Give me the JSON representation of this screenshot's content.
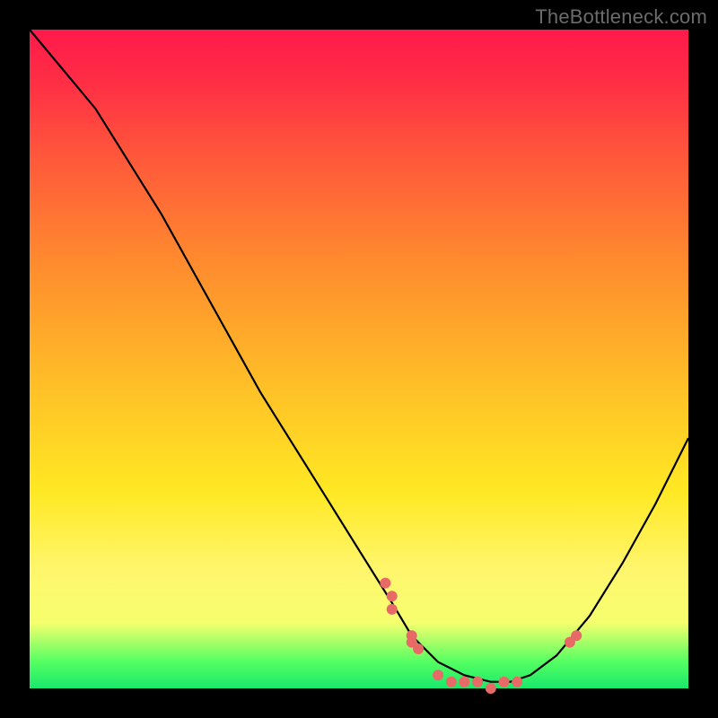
{
  "watermark": "TheBottleneck.com",
  "colors": {
    "page_background": "#000000",
    "gradient_top": "#ff1a4b",
    "gradient_mid": "#ffe823",
    "gradient_bottom": "#19e86b",
    "curve": "#000000",
    "marker": "#e86a66",
    "watermark": "#6b6b6b"
  },
  "chart_data": {
    "type": "line",
    "title": "",
    "xlabel": "",
    "ylabel": "",
    "xlim": [
      0,
      100
    ],
    "ylim": [
      0,
      100
    ],
    "series": [
      {
        "name": "bottleneck-curve",
        "x": [
          0,
          5,
          10,
          15,
          20,
          25,
          30,
          35,
          40,
          45,
          50,
          55,
          58,
          62,
          66,
          70,
          73,
          76,
          80,
          85,
          90,
          95,
          100
        ],
        "y": [
          100,
          94,
          88,
          80,
          72,
          63,
          54,
          45,
          37,
          29,
          21,
          13,
          8,
          4,
          2,
          1,
          1,
          2,
          5,
          11,
          19,
          28,
          38
        ]
      }
    ],
    "markers": [
      {
        "x": 54,
        "y": 16
      },
      {
        "x": 55,
        "y": 14
      },
      {
        "x": 55,
        "y": 12
      },
      {
        "x": 58,
        "y": 8
      },
      {
        "x": 58,
        "y": 7
      },
      {
        "x": 59,
        "y": 6
      },
      {
        "x": 62,
        "y": 2
      },
      {
        "x": 64,
        "y": 1
      },
      {
        "x": 66,
        "y": 1
      },
      {
        "x": 68,
        "y": 1
      },
      {
        "x": 70,
        "y": 0
      },
      {
        "x": 72,
        "y": 1
      },
      {
        "x": 74,
        "y": 1
      },
      {
        "x": 82,
        "y": 7
      },
      {
        "x": 83,
        "y": 8
      }
    ]
  }
}
